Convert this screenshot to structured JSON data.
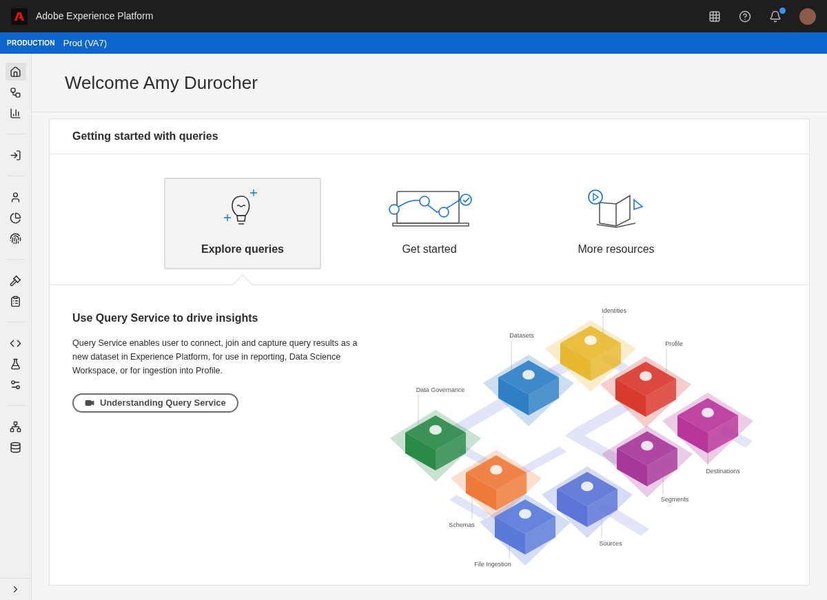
{
  "header": {
    "title": "Adobe Experience Platform",
    "notifications_unread": true
  },
  "sandbox": {
    "type": "PRODUCTION",
    "name": "Prod (VA7)"
  },
  "sidebar": {
    "groups": [
      [
        {
          "selected": true
        },
        {
          "selected": false
        },
        {
          "selected": false
        }
      ],
      [
        {
          "selected": false
        }
      ],
      [
        {
          "selected": false
        },
        {
          "selected": false
        },
        {
          "selected": false
        }
      ],
      [
        {
          "selected": false
        },
        {
          "selected": false
        }
      ],
      [
        {
          "selected": false
        },
        {
          "selected": false
        },
        {
          "selected": false
        }
      ],
      [
        {
          "selected": false
        },
        {
          "selected": false
        }
      ]
    ]
  },
  "page_title": "Welcome Amy Durocher",
  "card": {
    "title": "Getting started with queries",
    "options": [
      {
        "label": "Explore queries",
        "selected": true
      },
      {
        "label": "Get started",
        "selected": false
      },
      {
        "label": "More resources",
        "selected": false
      }
    ],
    "section_title": "Use Query Service to drive insights",
    "description": "Query Service enables user to connect, join and capture query results as a new dataset in Experience Platform, for use in reporting, Data Science Workspace, or for ingestion into Profile.",
    "video_button": "Understanding Query Service",
    "diagram_nodes": [
      {
        "label": "Identities",
        "color": "#e8b830"
      },
      {
        "label": "Datasets",
        "color": "#2f7fc4"
      },
      {
        "label": "Profile",
        "color": "#d93a2e"
      },
      {
        "label": "Data Governance",
        "color": "#2a8a48"
      },
      {
        "label": "Destinations",
        "color": "#b8369a"
      },
      {
        "label": "Segments",
        "color": "#a8379a"
      },
      {
        "label": "Schemas",
        "color": "#ee7a3a"
      },
      {
        "label": "Sources",
        "color": "#5b74d6"
      },
      {
        "label": "File Ingestion",
        "color": "#5a7ad8"
      }
    ]
  }
}
